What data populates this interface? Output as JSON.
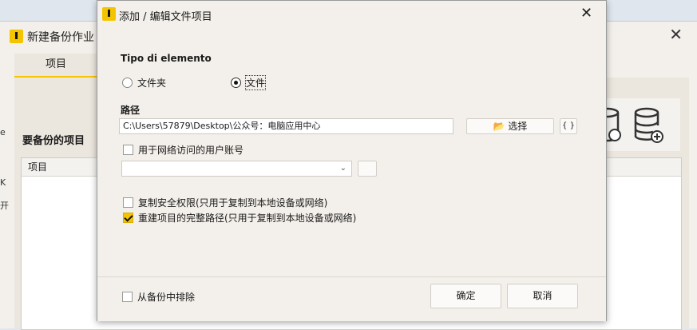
{
  "background_window": {
    "title": "新建备份作业",
    "tab_label": "项目",
    "items_label": "要备份的项目",
    "table_header": "项目",
    "left_fragments": [
      "e",
      "K",
      "开"
    ]
  },
  "dialog": {
    "title": "添加 / 编辑文件项目",
    "element_type": {
      "label": "Tipo di elemento",
      "options": [
        {
          "label": "文件夹",
          "selected": false
        },
        {
          "label": "文件",
          "selected": true
        }
      ]
    },
    "path": {
      "label": "路径",
      "value": "C:\\Users\\57879\\Desktop\\公众号：电脑应用中心",
      "choose_button": "选择",
      "braces_button": "{ }"
    },
    "network_account": {
      "label": "用于网络访问的用户账号",
      "checked": false,
      "selected_value": ""
    },
    "copy_permissions": {
      "label": "复制安全权限(只用于复制到本地设备或网络)",
      "checked": false
    },
    "rebuild_path": {
      "label": "重建项目的完整路径(只用于复制到本地设备或网络)",
      "checked": true
    },
    "exclude": {
      "label": "从备份中排除",
      "checked": false
    },
    "ok_button": "确定",
    "cancel_button": "取消"
  },
  "colors": {
    "accent": "#f5c400",
    "dialog_bg": "#f3f0eb"
  }
}
